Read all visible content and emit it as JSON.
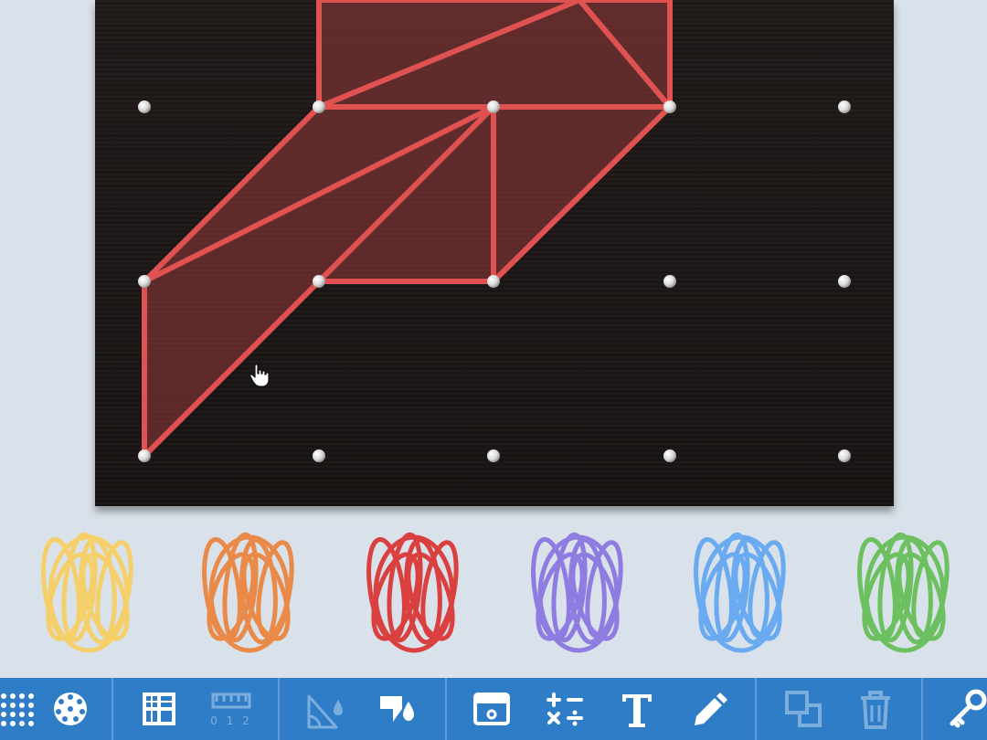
{
  "bands": [
    {
      "color": "yellow",
      "hex": "#f5d06a"
    },
    {
      "color": "orange",
      "hex": "#e98a48"
    },
    {
      "color": "red",
      "hex": "#d9403f"
    },
    {
      "color": "purple",
      "hex": "#8e7ce0"
    },
    {
      "color": "blue",
      "hex": "#6aaaf0"
    },
    {
      "color": "green",
      "hex": "#6cc060"
    }
  ],
  "toolbar": {
    "ruler_numbers": "0 1 2",
    "tools": [
      "grid-dots-icon",
      "circle-dots-icon",
      "grid-lines-icon",
      "ruler-icon",
      "angle-measure-icon",
      "fill-paint-icon",
      "hide-board-icon",
      "math-operations-icon",
      "text-icon",
      "pencil-icon",
      "duplicate-icon",
      "trash-icon",
      "key-icon"
    ]
  },
  "colors": {
    "toolbar": "#2f7dc6",
    "board": "#1c1716",
    "band_selected": "#e05252"
  }
}
